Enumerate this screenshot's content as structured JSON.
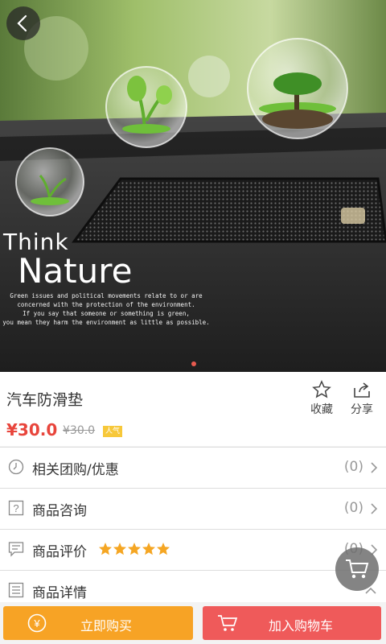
{
  "hero": {
    "headline_1": "Think",
    "headline_2": "Nature",
    "body_lines": [
      "Green issues and political movements relate to or are",
      "concerned with the protection of the environment.",
      "If you say that someone or something is green,",
      "you mean they harm the environment as little as possible."
    ]
  },
  "product": {
    "title": "汽车防滑垫",
    "price": "¥30.0",
    "original_price": "¥30.0",
    "tag": "人气"
  },
  "actions": {
    "favorite_label": "收藏",
    "share_label": "分享"
  },
  "rows": {
    "group_buy": {
      "label": "相关团购/优惠",
      "count": "(0)"
    },
    "consult": {
      "label": "商品咨询",
      "count": "(0)"
    },
    "review": {
      "label": "商品评价",
      "count": "(0)",
      "rating": 5
    },
    "detail": {
      "label": "商品详情"
    }
  },
  "bottom_bar": {
    "buy_label": "立即购买",
    "cart_label": "加入购物车"
  },
  "colors": {
    "accent_red": "#e8453c",
    "buy_orange": "#f7a325",
    "cart_red": "#ef5a5a",
    "star_yellow": "#f5a623"
  }
}
